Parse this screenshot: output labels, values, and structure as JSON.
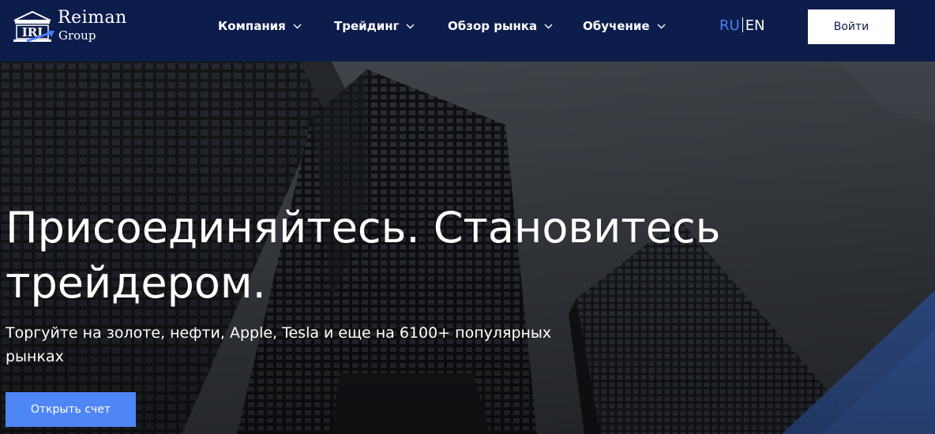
{
  "header": {
    "logo": {
      "name": "Reiman",
      "sub": "Group",
      "mark_letters": "IRI"
    },
    "nav": [
      {
        "label": "Компания",
        "icon": "chevron-down-icon"
      },
      {
        "label": "Трейдинг",
        "icon": "chevron-down-icon"
      },
      {
        "label": "Обзор рынка",
        "icon": "chevron-down-icon"
      },
      {
        "label": "Обучение",
        "icon": "chevron-down-icon"
      }
    ],
    "lang": {
      "ru": "RU",
      "en": "EN",
      "active": "RU"
    },
    "login_label": "Войти"
  },
  "hero": {
    "title": "Присоединяйтесь. Становитесь трейдером.",
    "subtitle": "Торгуйте на золоте, нефти, Apple, Tesla и еще на 6100+ популярных рынках",
    "cta_label": "Открыть счет"
  },
  "colors": {
    "nav_bg": "#0c1d4c",
    "accent": "#4f86f5",
    "lang_active": "#4b7df2",
    "text_light": "#ffffff"
  }
}
